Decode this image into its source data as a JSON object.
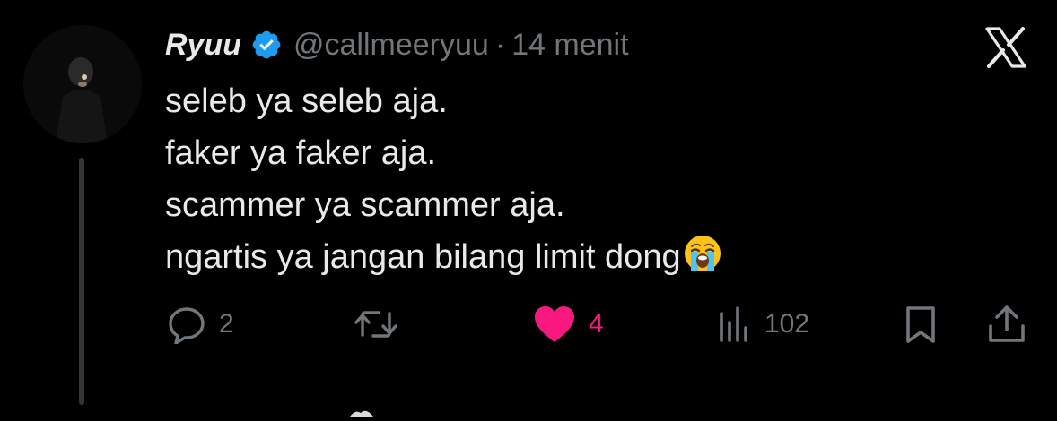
{
  "tweet": {
    "display_name": "Ryuu",
    "handle": "@callmeeryuu",
    "separator": "·",
    "time_ago": "14 menit",
    "lines": [
      "seleb ya seleb aja.",
      "faker ya faker aja.",
      "scammer ya scammer aja.",
      "ngartis ya jangan bilang limit dong"
    ],
    "emoji": "loudly-crying-face"
  },
  "actions": {
    "replies": "2",
    "retweets": "",
    "likes": "4",
    "views": "102"
  },
  "colors": {
    "background": "#000000",
    "text": "#e7e9ea",
    "muted": "#71767b",
    "like": "#f91880",
    "verified": "#1d9bf0",
    "thread_line": "#333639"
  },
  "icons": {
    "verified": "verified-badge-icon",
    "close": "x-logo-icon",
    "reply": "reply-icon",
    "retweet": "retweet-icon",
    "like": "heart-icon",
    "views": "views-icon",
    "bookmark": "bookmark-icon",
    "share": "share-icon"
  },
  "state": {
    "liked": true,
    "verified": true
  }
}
